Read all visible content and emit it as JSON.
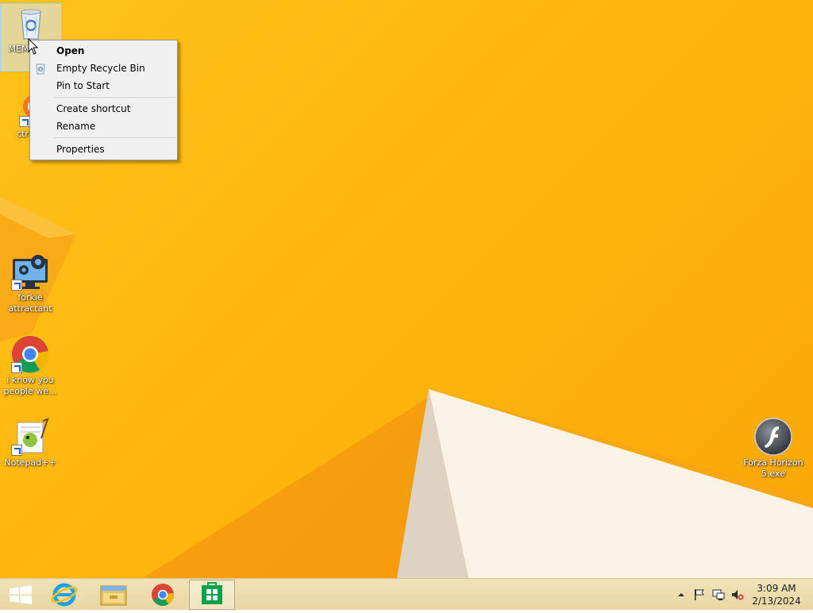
{
  "desktop": {
    "icons": [
      {
        "label": "MEMZ ctiv",
        "icon": "recycle-bin-icon"
      },
      {
        "label": "ctrl+a",
        "icon": "avast-icon"
      },
      {
        "label": "forkie attractant",
        "icon": "computer-settings-icon"
      },
      {
        "label": "i know you people we...",
        "icon": "chrome-icon"
      },
      {
        "label": "Notepad++",
        "icon": "notepadplusplus-icon"
      },
      {
        "label": "Forza Horizon 5.exe",
        "icon": "flash-icon"
      }
    ]
  },
  "context_menu": {
    "items": [
      {
        "label": "Open",
        "default": true
      },
      {
        "label": "Empty Recycle Bin",
        "icon": "recycle-bin-small-icon"
      },
      {
        "label": "Pin to Start"
      },
      {
        "label": "Create shortcut"
      },
      {
        "label": "Rename"
      },
      {
        "label": "Properties"
      }
    ]
  },
  "taskbar": {
    "buttons": [
      {
        "name": "start",
        "icon": "windows-logo-icon"
      },
      {
        "name": "internet-explorer",
        "icon": "internet-explorer-icon"
      },
      {
        "name": "file-explorer",
        "icon": "file-explorer-icon"
      },
      {
        "name": "chrome",
        "icon": "chrome-icon"
      },
      {
        "name": "store",
        "icon": "store-icon",
        "active": true
      }
    ],
    "tray": {
      "icons": [
        "chevron-up-icon",
        "flag-icon",
        "network-icon",
        "speaker-muted-icon"
      ],
      "time": "3:09 AM",
      "date": "2/13/2024"
    }
  },
  "colors": {
    "wallpaper": "#ffb70e",
    "taskbar": "#ecdcaa",
    "menu_bg": "#f0f0f0"
  }
}
